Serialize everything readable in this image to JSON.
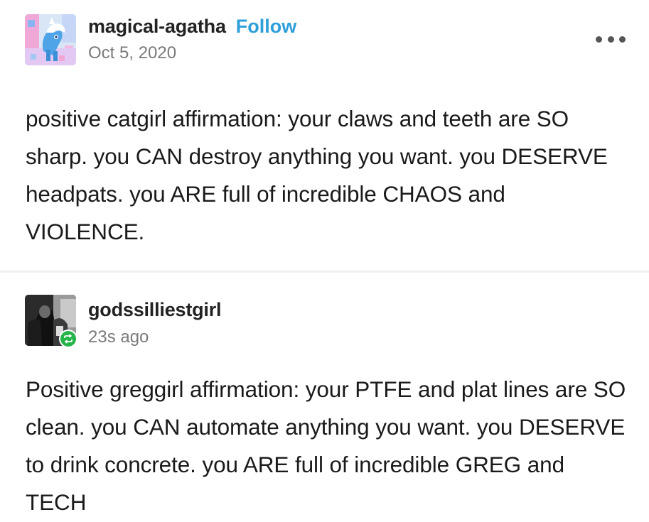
{
  "posts": [
    {
      "username": "magical-agatha",
      "follow_label": "Follow",
      "timestamp": "Oct 5, 2020",
      "avatar_icon": "pony-avatar-icon",
      "more_icon": "more-options-icon",
      "body": "positive catgirl affirmation: your claws and teeth are SO sharp. you CAN destroy anything you want. you DESERVE headpats. you ARE full of incredible CHAOS and VIOLENCE."
    },
    {
      "username": "godssilliestgirl",
      "timestamp": "23s ago",
      "avatar_icon": "photo-avatar-icon",
      "reblog_icon": "reblog-icon",
      "body": "Positive greggirl affirmation: your PTFE and plat lines are SO clean. you CAN automate anything you want. you DESERVE to drink concrete. you ARE full of incredible GREG and TECH"
    }
  ],
  "colors": {
    "follow": "#2e9fd9",
    "reblog_badge": "#25b44a",
    "timestamp": "#7a7a7a"
  }
}
